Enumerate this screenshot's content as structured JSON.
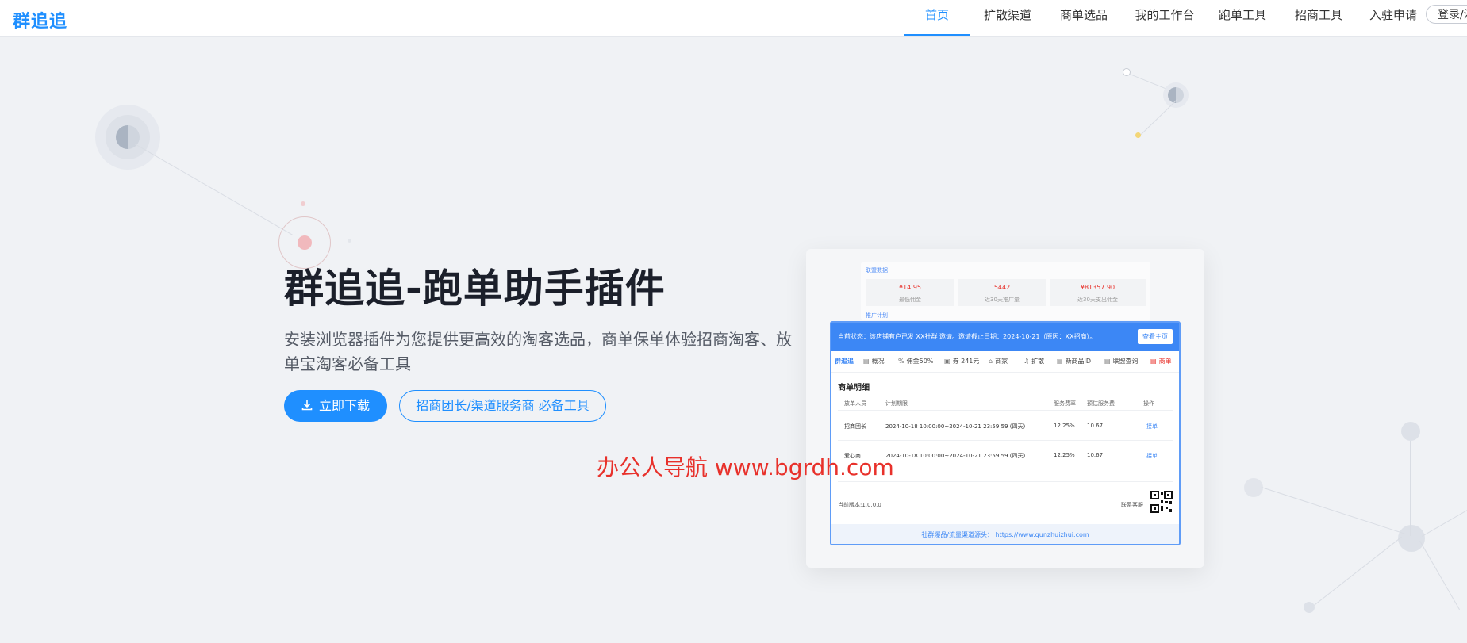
{
  "header": {
    "logo": "群追追",
    "nav": [
      {
        "label": "首页",
        "active": true
      },
      {
        "label": "扩散渠道",
        "active": false
      },
      {
        "label": "商单选品",
        "active": false
      },
      {
        "label": "我的工作台",
        "active": false
      },
      {
        "label": "跑单工具",
        "active": false
      },
      {
        "label": "招商工具",
        "active": false
      },
      {
        "label": "入驻申请",
        "active": false
      }
    ],
    "login": "登录/注册"
  },
  "hero": {
    "title": "群追追-跑单助手插件",
    "description": "安装浏览器插件为您提供更高效的淘客选品，商单保单体验招商淘客、放单宝淘客必备工具",
    "download_button": "立即下载",
    "secondary_button": "招商团长/渠道服务商 必备工具"
  },
  "watermark": "办公人导航 www.bgrdh.com",
  "mockup": {
    "top": {
      "section_label": "联盟数据",
      "stats": [
        {
          "value": "¥14.95",
          "label": "最低佣金"
        },
        {
          "value": "5442",
          "label": "近30天推广量"
        },
        {
          "value": "¥81357.90",
          "label": "近30天支出佣金"
        }
      ],
      "section_label2": "推广计划"
    },
    "banner": {
      "text": "当前状态：该店铺有户已发 XX社群 邀请。邀请截止日期：2024-10-21（原因：XX招商）。",
      "button": "查看主页"
    },
    "tabs": [
      {
        "icon": "",
        "label": "群追追"
      },
      {
        "icon": "▤",
        "label": "概况"
      },
      {
        "icon": "%",
        "label": "佣金50%"
      },
      {
        "icon": "▣",
        "label": "券 241元"
      },
      {
        "icon": "⌂",
        "label": "商家"
      },
      {
        "icon": "♫",
        "label": "扩散"
      },
      {
        "icon": "▤",
        "label": "新商品ID"
      },
      {
        "icon": "▤",
        "label": "联盟查询"
      },
      {
        "icon": "▤",
        "label": "商单"
      }
    ],
    "section_title": "商单明细",
    "table": {
      "headers": [
        "放单人员",
        "计划期限",
        "服务费率",
        "预估服务费",
        "操作"
      ],
      "rows": [
        [
          "招商团长",
          "2024-10-18 10:00:00~2024-10-21 23:59:59 (四天)",
          "12.25%",
          "10.67",
          "接单"
        ],
        [
          "爱心商",
          "2024-10-18 10:00:00~2024-10-21 23:59:59 (四天)",
          "12.25%",
          "10.67",
          "接单"
        ]
      ]
    },
    "version": "当前版本:1.0.0.0",
    "contact": "联系客服",
    "footer": "社群爆品/流量渠道源头： https://www.qunzhuizhui.com"
  },
  "colors": {
    "brand": "#1f8fff",
    "panel_blue": "#3c87f5",
    "price_red": "#e8312b",
    "background": "#f0f2f5"
  }
}
